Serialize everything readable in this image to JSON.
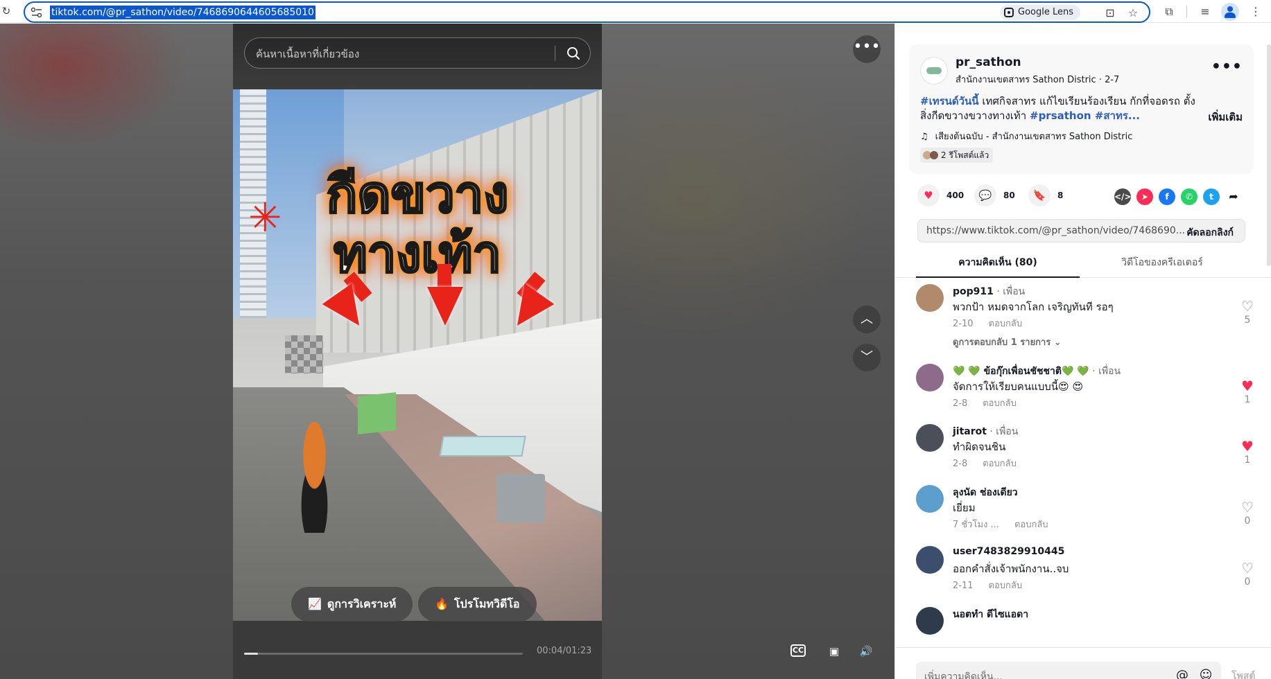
{
  "browser": {
    "url": "tiktok.com/@pr_sathon/video/7468690644605685010",
    "lens_label": "Google Lens"
  },
  "video": {
    "search_placeholder": "ค้นหาเนื้อหาที่เกี่ยวข้อง",
    "headline_line1": "กีดขวาง",
    "headline_line2": "ทางเท้า",
    "analytics_label": "ดูการวิเคราะห์",
    "promote_label": "โปรโมทวิดีโอ",
    "timecode": "00:04/01:23",
    "progress": 0.05
  },
  "post": {
    "author": "pr_sathon",
    "author_sub": "สำนักงานเขตสาทร Sathon Distric · 2-7",
    "caption_tag1": "#เทรนด์วันนี้",
    "caption_text": " เทศกิจสาทร แก้ไขเรียนร้องเรียน กักที่จอดรถ ตั้งสิ่งกีดขวางขวางทางเท้า ",
    "caption_tag2": "#prsathon",
    "caption_tag3": " #สาทร...",
    "see_more": "เพิ่มเติม",
    "music": "เสียงต้นฉบับ - สำนักงานเขตสาทร Sathon Distric",
    "reposts": "2 รีโพสต์แล้ว",
    "likes": "400",
    "comments": "80",
    "saves": "8",
    "link": "https://www.tiktok.com/@pr_sathon/video/7468690...",
    "copy_link": "คัดลอกลิงก์"
  },
  "tabs": {
    "comments": "ความคิดเห็น (80)",
    "creator_videos": "วิดีโอของครีเอเตอร์"
  },
  "comments": [
    {
      "name": "pop911",
      "rel": " · เพื่อน",
      "text": "พวกป้า หมดจากโลก เจริญทันที รอๆ",
      "date": "2-10",
      "reply": "ตอบกลับ",
      "likes": "5",
      "liked": false,
      "view_replies": "ดูการตอบกลับ 1 รายการ ⌄",
      "avatar_color": "#b08a6a"
    },
    {
      "name": "💚 💚 ข้อกุ๊กเพื่อนชัชชาติ💚 💚",
      "rel": " · เพื่อน",
      "text": "จัดการให้เรียบคนแบบนี้😍 😍",
      "date": "2-8",
      "reply": "ตอบกลับ",
      "likes": "1",
      "liked": true,
      "avatar_color": "#8e6b8a"
    },
    {
      "name": "jitarot",
      "rel": " · เพื่อน",
      "text": "ทำผิดจนชิน",
      "date": "2-8",
      "reply": "ตอบกลับ",
      "likes": "1",
      "liked": true,
      "avatar_color": "#4a4f5a"
    },
    {
      "name": "ลุงนัด ช่องเดียว",
      "rel": "",
      "text": "เยี่ยม",
      "date": "7 ชั่วโมง ...",
      "reply": "ตอบกลับ",
      "likes": "0",
      "liked": false,
      "avatar_color": "#5c9fcf"
    },
    {
      "name": "user7483829910445",
      "rel": "",
      "text": "ออกคำสั่งเจ้าพนักงาน..จบ",
      "date": "2-11",
      "reply": "ตอบกลับ",
      "likes": "0",
      "liked": false,
      "avatar_color": "#3b4e6e"
    },
    {
      "name": "นอตทำ ดีไซแอดา",
      "rel": "",
      "text": "",
      "date": "",
      "reply": "",
      "likes": "",
      "liked": false,
      "avatar_color": "#2f3b4a"
    }
  ],
  "comment_bar": {
    "placeholder": "เพิ่มความคิดเห็น...",
    "post_label": "โพสต์"
  },
  "colors": {
    "accent": "#fe2c55",
    "hashtag": "#2b5db9",
    "url_highlight": "#0b57d0"
  }
}
